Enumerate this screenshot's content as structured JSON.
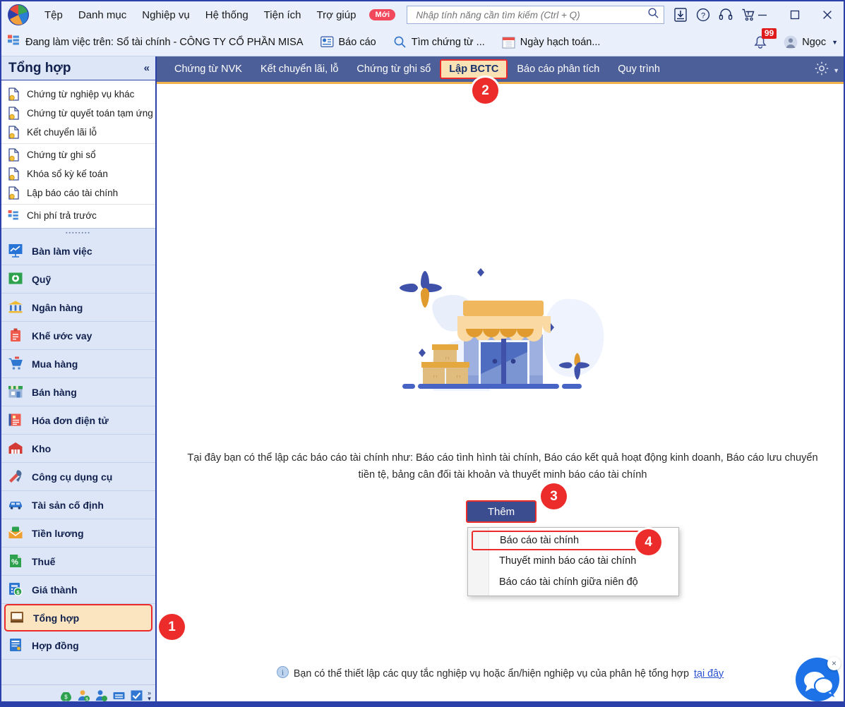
{
  "titlebar": {
    "menu": [
      {
        "label": "Tệp",
        "name": "menu-tep"
      },
      {
        "label": "Danh mục",
        "name": "menu-danh-muc"
      },
      {
        "label": "Nghiệp vụ",
        "name": "menu-nghiep-vu"
      },
      {
        "label": "Hệ thống",
        "name": "menu-he-thong"
      },
      {
        "label": "Tiện ích",
        "name": "menu-tien-ich"
      },
      {
        "label": "Trợ giúp",
        "name": "menu-tro-giup"
      }
    ],
    "new_badge": "Mới",
    "search_placeholder": "Nhập tính năng cần tìm kiếm (Ctrl + Q)",
    "icons": [
      "download-icon",
      "help-circle-icon",
      "headset-icon",
      "cart-icon"
    ],
    "window_controls": [
      "minimize-icon",
      "maximize-icon",
      "close-icon"
    ]
  },
  "subbar": {
    "context_label": "Đang làm việc trên: Sổ tài chính - CÔNG TY CỔ PHẦN MISA",
    "buttons": [
      {
        "label": "Báo cáo",
        "icon": "report-icon"
      },
      {
        "label": "Tìm chứng từ ...",
        "icon": "search-icon"
      },
      {
        "label": "Ngày hạch toán...",
        "icon": "calendar-icon"
      }
    ],
    "notification_count": "99",
    "user_name": "Ngọc"
  },
  "sidebar": {
    "title": "Tổng hợp",
    "collapse_icon": "chevron-double-left-icon",
    "groups": [
      {
        "links": [
          {
            "label": "Chứng từ nghiệp vụ khác",
            "name": "sidebar-link-chung-tu-nghiep-vu-khac"
          },
          {
            "label": "Chứng từ quyết toán tạm ứng",
            "name": "sidebar-link-chung-tu-quyet-toan-tam-ung"
          },
          {
            "label": "Kết chuyển lãi lỗ",
            "name": "sidebar-link-ket-chuyen-lai-lo"
          }
        ]
      },
      {
        "links": [
          {
            "label": "Chứng từ ghi sổ",
            "name": "sidebar-link-chung-tu-ghi-so"
          },
          {
            "label": "Khóa sổ kỳ kế toán",
            "name": "sidebar-link-khoa-so-ky-ke-toan"
          },
          {
            "label": "Lập báo cáo tài chính",
            "name": "sidebar-link-lap-bao-cao-tai-chinh"
          }
        ]
      },
      {
        "links": [
          {
            "label": "Chi phí trả trước",
            "name": "sidebar-link-chi-phi-tra-truoc"
          }
        ]
      }
    ],
    "modules": [
      {
        "label": "Bàn làm việc",
        "icon": "dashboard-icon",
        "active": false
      },
      {
        "label": "Quỹ",
        "icon": "safe-icon",
        "active": false
      },
      {
        "label": "Ngân hàng",
        "icon": "bank-icon",
        "active": false
      },
      {
        "label": "Khế ước vay",
        "icon": "loan-icon",
        "active": false
      },
      {
        "label": "Mua hàng",
        "icon": "cart-icon",
        "active": false
      },
      {
        "label": "Bán hàng",
        "icon": "shop-icon",
        "active": false
      },
      {
        "label": "Hóa đơn điện tử",
        "icon": "einvoice-icon",
        "active": false
      },
      {
        "label": "Kho",
        "icon": "warehouse-icon",
        "active": false
      },
      {
        "label": "Công cụ dụng cụ",
        "icon": "tools-icon",
        "active": false
      },
      {
        "label": "Tài sản cố định",
        "icon": "car-icon",
        "active": false
      },
      {
        "label": "Tiền lương",
        "icon": "payroll-icon",
        "active": false
      },
      {
        "label": "Thuế",
        "icon": "percent-icon",
        "active": false
      },
      {
        "label": "Giá thành",
        "icon": "cost-icon",
        "active": false
      },
      {
        "label": "Tổng hợp",
        "icon": "ledger-icon",
        "active": true
      },
      {
        "label": "Hợp đồng",
        "icon": "contract-icon",
        "active": false
      }
    ],
    "footer_icons": [
      "money-bag-icon",
      "customer-icon",
      "employee-icon",
      "inbox-icon",
      "checkbox-icon"
    ],
    "footer_more": "»"
  },
  "tabs": [
    {
      "label": "Chứng từ NVK",
      "active": false
    },
    {
      "label": "Kết chuyển lãi, lỗ",
      "active": false
    },
    {
      "label": "Chứng từ ghi sổ",
      "active": false
    },
    {
      "label": "Lập BCTC",
      "active": true
    },
    {
      "label": "Báo cáo phân tích",
      "active": false
    },
    {
      "label": "Quy trình",
      "active": false
    }
  ],
  "tabstrip_gear": "gear-icon",
  "main": {
    "illustration": "storefront-illustration",
    "blurb": "Tại đây bạn có thể lập các báo cáo tài chính như: Báo cáo tình hình tài chính, Báo cáo kết quả hoạt động kinh doanh, Báo cáo lưu chuyển tiền tệ, bảng cân đối tài khoản và thuyết minh báo cáo tài chính",
    "add_button": "Thêm",
    "dropdown_items": [
      {
        "label": "Báo cáo tài chính",
        "selected": true
      },
      {
        "label": "Thuyết minh báo cáo tài chính",
        "selected": false
      },
      {
        "label": "Báo cáo tài chính giữa niên độ",
        "selected": false
      }
    ],
    "footnote_text": "Bạn có thể thiết lập các quy tắc nghiệp vụ hoặc ẩn/hiện nghiệp vụ của phân hệ tổng hợp",
    "footnote_link": "tại đây",
    "footnote_icon": "info-icon",
    "chat_icon": "chat-bubble-icon",
    "chat_close": "×"
  },
  "callouts": [
    {
      "number": "1"
    },
    {
      "number": "2"
    },
    {
      "number": "3"
    },
    {
      "number": "4"
    }
  ],
  "colors": {
    "accent_red": "#ec2b2b",
    "brand_blue": "#2b40a8",
    "tabstrip": "#4d5f99",
    "highlight_yellow": "#fbe2b4",
    "sidebar_bg": "#dce6f7"
  }
}
